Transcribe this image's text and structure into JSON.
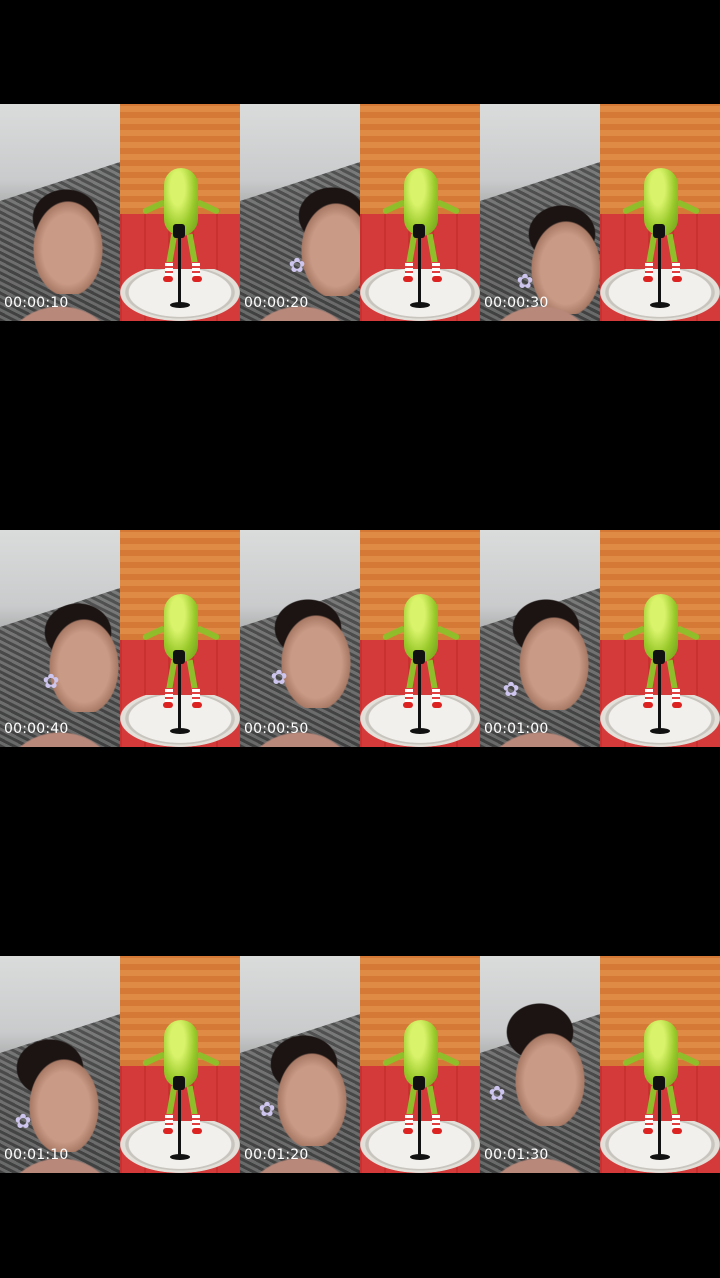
{
  "frames": [
    {
      "timestamp": "00:00:10"
    },
    {
      "timestamp": "00:00:20"
    },
    {
      "timestamp": "00:00:30"
    },
    {
      "timestamp": "00:00:40"
    },
    {
      "timestamp": "00:00:50"
    },
    {
      "timestamp": "00:01:00"
    },
    {
      "timestamp": "00:01:10"
    },
    {
      "timestamp": "00:01:20"
    },
    {
      "timestamp": "00:01:30"
    }
  ],
  "colors": {
    "background": "#000000",
    "timestamp_text": "#ffffff",
    "pickle_wall": "#d9803b",
    "pickle_floor": "#d53a3a",
    "pickle_body": "#98c92a"
  },
  "icons": {
    "flower": "flower-icon",
    "microphone": "microphone-icon"
  }
}
